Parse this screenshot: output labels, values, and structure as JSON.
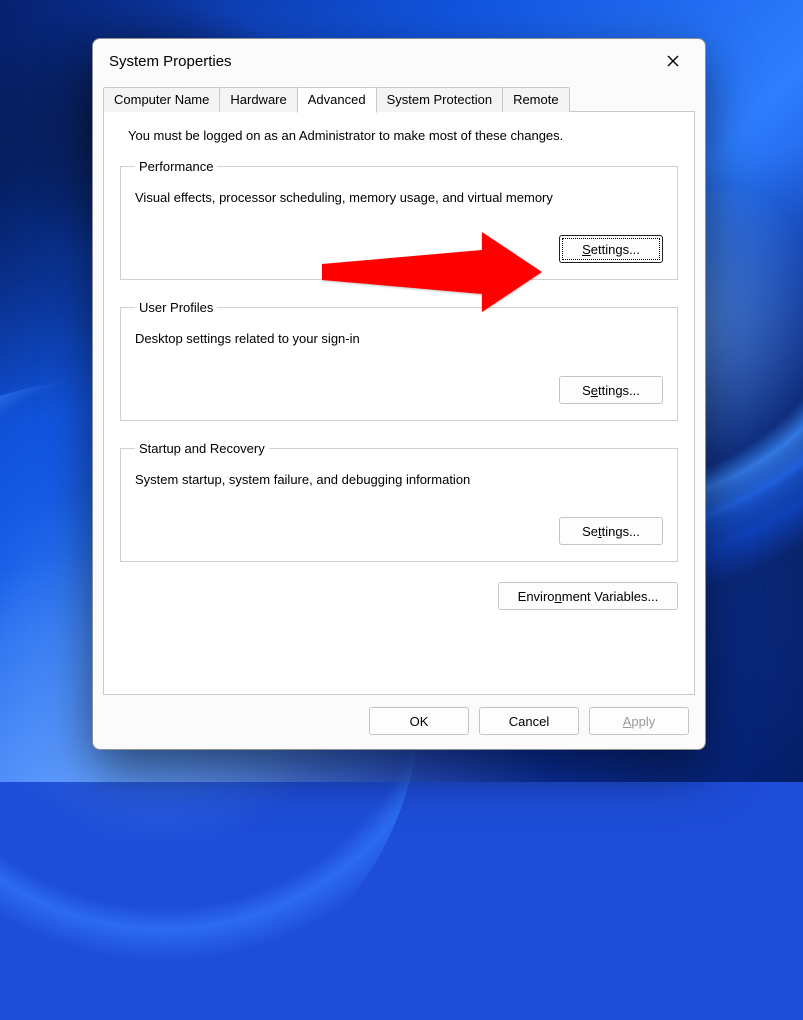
{
  "dialog": {
    "title": "System Properties",
    "tabs": [
      {
        "label": "Computer Name"
      },
      {
        "label": "Hardware"
      },
      {
        "label": "Advanced"
      },
      {
        "label": "System Protection"
      },
      {
        "label": "Remote"
      }
    ],
    "active_tab_index": 2,
    "admin_note": "You must be logged on as an Administrator to make most of these changes.",
    "groups": {
      "performance": {
        "legend": "Performance",
        "desc": "Visual effects, processor scheduling, memory usage, and virtual memory",
        "button_label": "Settings...",
        "button_accel": "S"
      },
      "user_profiles": {
        "legend": "User Profiles",
        "desc": "Desktop settings related to your sign-in",
        "button_label": "Settings...",
        "button_accel": "e"
      },
      "startup_recovery": {
        "legend": "Startup and Recovery",
        "desc": "System startup, system failure, and debugging information",
        "button_label": "Settings...",
        "button_accel": "t"
      }
    },
    "env_button_label": "Environment Variables...",
    "env_accel": "n",
    "footer": {
      "ok_label": "OK",
      "cancel_label": "Cancel",
      "apply_label": "Apply",
      "apply_accel": "A"
    }
  }
}
